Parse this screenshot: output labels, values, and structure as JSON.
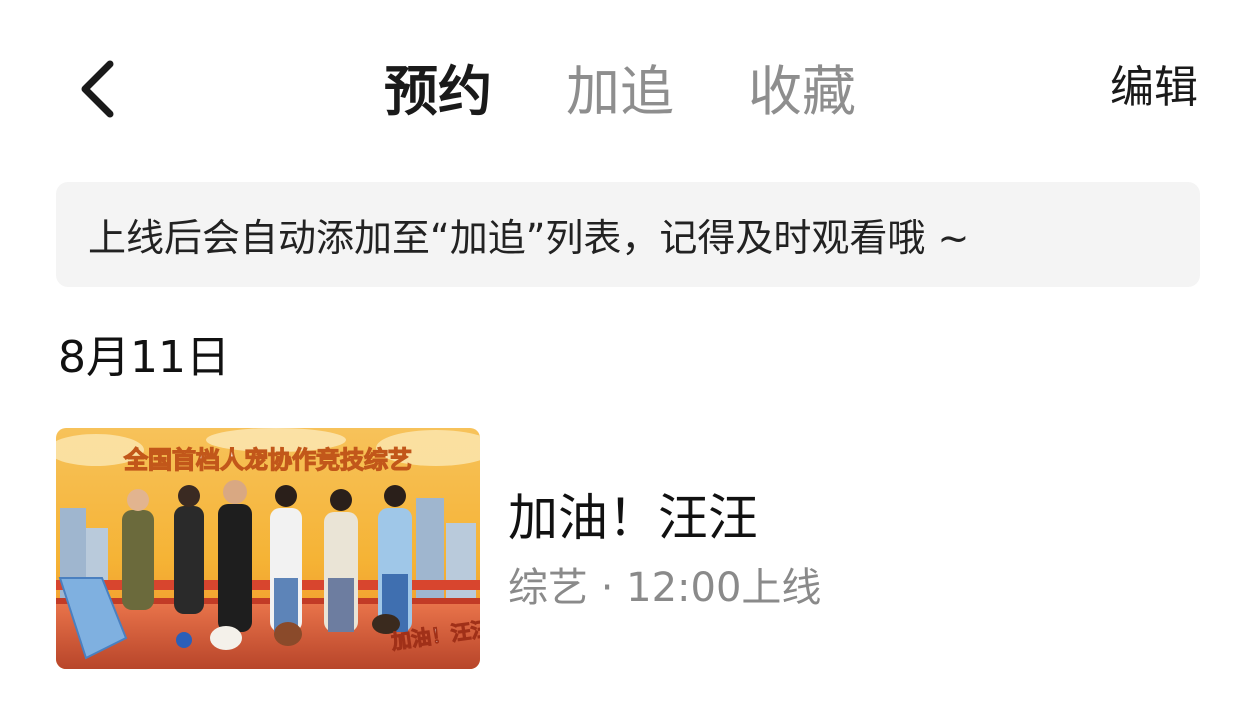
{
  "header": {
    "tabs": [
      {
        "label": "预约",
        "active": true
      },
      {
        "label": "加追",
        "active": false
      },
      {
        "label": "收藏",
        "active": false
      }
    ],
    "edit_label": "编辑",
    "back_icon": "chevron-left-icon"
  },
  "notice": {
    "text": "上线后会自动添加至“加追”列表，记得及时观看哦 ~"
  },
  "schedule": {
    "date": "8月11日",
    "items": [
      {
        "title": "加油！汪汪",
        "meta": "综艺 · 12:00上线",
        "poster": {
          "headline": "全国首档人宠协作竞技综艺",
          "logo_text": "加油！汪汪"
        }
      }
    ]
  },
  "colors": {
    "active_tab": "#1a1a1a",
    "inactive_tab": "#8e8e8e",
    "notice_bg": "#f4f4f4",
    "meta_text": "#8a8a8a",
    "poster_sky": "#f5b335",
    "poster_bridge": "#d8452e"
  }
}
